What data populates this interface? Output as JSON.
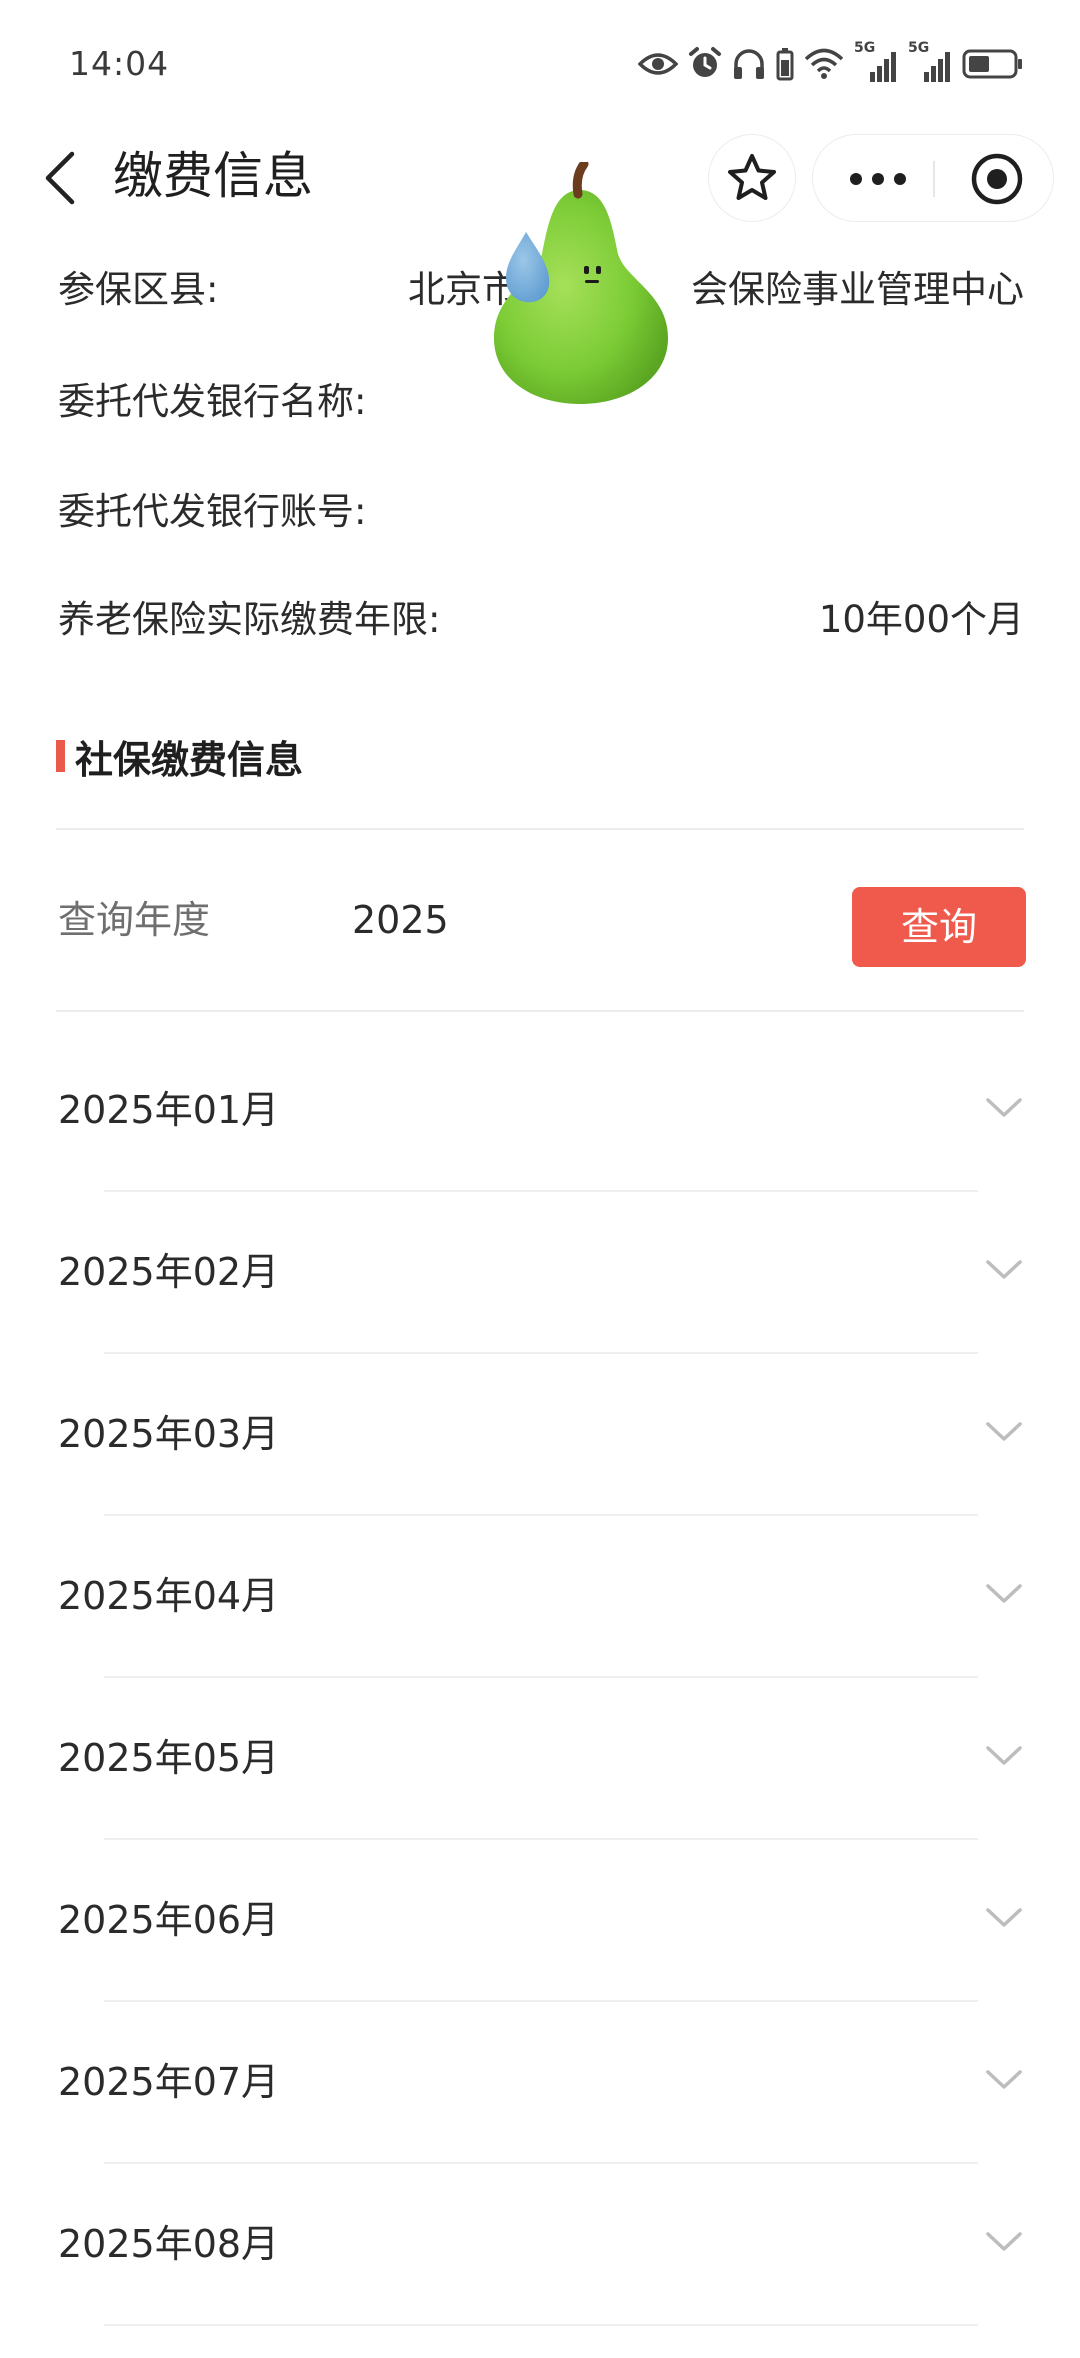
{
  "status_bar": {
    "time": "14:04",
    "icons": [
      "eye-icon",
      "alarm-icon",
      "headphones-icon",
      "battery-small-icon",
      "wifi-icon",
      "signal-5g-icon",
      "signal-5g-icon",
      "battery-icon"
    ],
    "network_label_1": "5G",
    "network_label_2": "5G"
  },
  "nav": {
    "title": "缴费信息",
    "back_icon": "chevron-left-icon",
    "favorite_icon": "star-icon",
    "more_icon": "more-dots-icon",
    "close_icon": "target-circle-icon"
  },
  "info": {
    "district_label": "参保区县:",
    "district_value": "北京市",
    "district_value_tail": "会保险事业管理中心",
    "bank_name_label": "委托代发银行名称:",
    "bank_account_label": "委托代发银行账号:",
    "pension_years_label": "养老保险实际缴费年限:",
    "pension_years_value": "10年00个月"
  },
  "section": {
    "title": "社保缴费信息",
    "accent_color": "#ea5a4b"
  },
  "query": {
    "label": "查询年度",
    "year": "2025",
    "button_label": "查询",
    "button_color": "#ef5a4d"
  },
  "months": [
    {
      "label": "2025年01月"
    },
    {
      "label": "2025年02月"
    },
    {
      "label": "2025年03月"
    },
    {
      "label": "2025年04月"
    },
    {
      "label": "2025年05月"
    },
    {
      "label": "2025年06月"
    },
    {
      "label": "2025年07月"
    },
    {
      "label": "2025年08月"
    }
  ]
}
